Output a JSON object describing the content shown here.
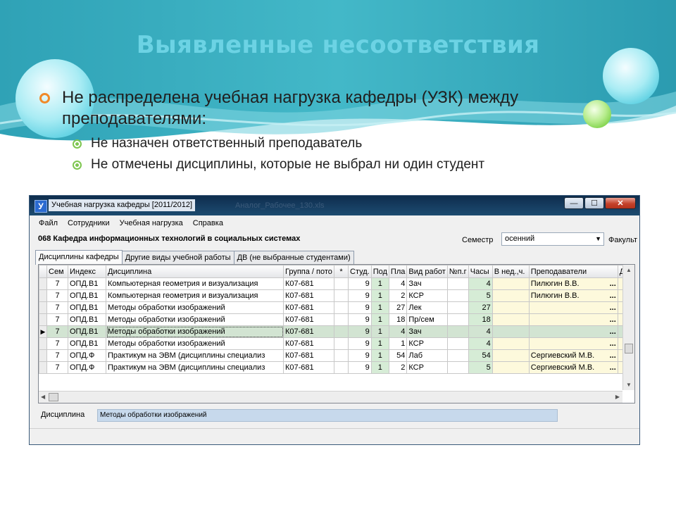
{
  "slide": {
    "title": "Выявленные несоответствия",
    "bullet1": "Не распределена учебная нагрузка кафедры (УЗК) между преподавателями:",
    "subbullets": [
      "Не назначен ответственный преподаватель",
      "Не отмечены дисциплины, которые не выбрал ни один студент"
    ]
  },
  "window": {
    "icon_letter": "У",
    "title": "Учебная нагрузка кафедры [2011/2012]",
    "ghost_title": "Аналог_Рабочее_130.xls",
    "buttons": {
      "minimize": "—",
      "maximize": "☐",
      "close": "✕"
    },
    "menu": [
      "Файл",
      "Сотрудники",
      "Учебная нагрузка",
      "Справка"
    ],
    "department": "068 Кафедра информационных технологий в социальных системах",
    "semester_label": "Семестр",
    "semester_value": "осенний",
    "faculty_label": "Факульт",
    "tabs": [
      "Дисциплины кафедры",
      "Другие виды учебной работы",
      "ДВ (не выбранные студентами)"
    ],
    "columns": [
      "Сем",
      "Индекс",
      "Дисциплина",
      "Группа / пото",
      "*",
      "Студ.",
      "Под",
      "Пла",
      "Вид работ",
      "№п.г",
      "Часы",
      "В нед.,ч.",
      "Преподаватели",
      "Дн"
    ],
    "rows": [
      {
        "sem": "7",
        "index": "ОПД.В1",
        "discipline": "Компьютерная геометрия и визуализация",
        "group": "К07-681",
        "students": "9",
        "sub": "1",
        "plan": "4",
        "work": "Зач",
        "hours": "4",
        "teacher": "Пилюгин В.В."
      },
      {
        "sem": "7",
        "index": "ОПД.В1",
        "discipline": "Компьютерная геометрия и визуализация",
        "group": "К07-681",
        "students": "9",
        "sub": "1",
        "plan": "2",
        "work": "КСР",
        "hours": "5",
        "teacher": "Пилюгин В.В."
      },
      {
        "sem": "7",
        "index": "ОПД.В1",
        "discipline": "Методы обработки изображений",
        "group": "К07-681",
        "students": "9",
        "sub": "1",
        "plan": "27",
        "work": "Лек",
        "hours": "27",
        "teacher": ""
      },
      {
        "sem": "7",
        "index": "ОПД.В1",
        "discipline": "Методы обработки изображений",
        "group": "К07-681",
        "students": "9",
        "sub": "1",
        "plan": "18",
        "work": "Пр/сем",
        "hours": "18",
        "teacher": ""
      },
      {
        "sem": "7",
        "index": "ОПД.В1",
        "discipline": "Методы обработки изображений",
        "group": "К07-681",
        "students": "9",
        "sub": "1",
        "plan": "4",
        "work": "Зач",
        "hours": "4",
        "teacher": ""
      },
      {
        "sem": "7",
        "index": "ОПД.В1",
        "discipline": "Методы обработки изображений",
        "group": "К07-681",
        "students": "9",
        "sub": "1",
        "plan": "1",
        "work": "КСР",
        "hours": "4",
        "teacher": ""
      },
      {
        "sem": "7",
        "index": "ОПД.Ф",
        "discipline": "Практикум на ЭВМ (дисциплины специализ",
        "group": "К07-681",
        "students": "9",
        "sub": "1",
        "plan": "54",
        "work": "Лаб",
        "hours": "54",
        "teacher": "Сергиевский М.В."
      },
      {
        "sem": "7",
        "index": "ОПД.Ф",
        "discipline": "Практикум на ЭВМ (дисциплины специализ",
        "group": "К07-681",
        "students": "9",
        "sub": "1",
        "plan": "2",
        "work": "КСР",
        "hours": "5",
        "teacher": "Сергиевский М.В."
      }
    ],
    "ellipsis": "...",
    "row_pointer": "▶",
    "discipline_label": "Дисциплина",
    "discipline_value": "Методы обработки изображений"
  }
}
